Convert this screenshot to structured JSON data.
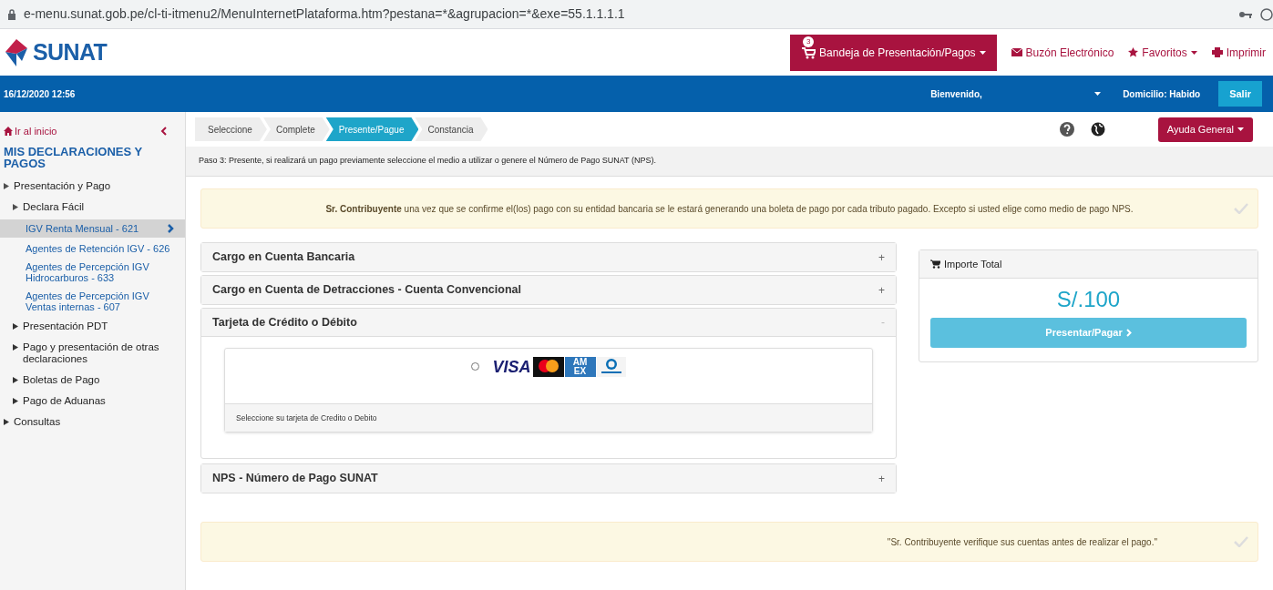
{
  "browser": {
    "url": "e-menu.sunat.gob.pe/cl-ti-itmenu2/MenuInternetPlataforma.htm?pestana=*&agrupacion=*&exe=55.1.1.1.1"
  },
  "header": {
    "logo": "SUNAT",
    "nav": [
      {
        "kind": "tray",
        "label": "Bandeja de Presentación/Pagos",
        "badge": "3"
      },
      {
        "kind": "mail",
        "label": "Buzón Electrónico"
      },
      {
        "kind": "favorites",
        "label": "Favoritos"
      },
      {
        "kind": "print",
        "label": "Imprimir"
      }
    ]
  },
  "user_bar": {
    "datetime": "16/12/2020 12:56",
    "greeting": "Bienvenido,",
    "domicile": "Domicilio: Habido",
    "logout": "Salir"
  },
  "sidebar": {
    "home": "Ir al inicio",
    "title": "MIS DECLARACIONES Y PAGOS",
    "items": [
      {
        "label": "Presentación y Pago",
        "expanded": true,
        "children": [
          {
            "label": "Declara Fácil",
            "expanded": true,
            "children": [
              {
                "label": "IGV Renta Mensual - 621",
                "selected": true
              },
              {
                "label": "Agentes de Retención IGV - 626",
                "selected": false
              },
              {
                "label": "Agentes de Percepción IGV Hidrocarburos - 633",
                "selected": false
              },
              {
                "label": "Agentes de Percepción IGV Ventas internas - 607",
                "selected": false
              }
            ]
          },
          {
            "label": "Presentación PDT",
            "expanded": false
          },
          {
            "label": "Pago y presentación de otras declaraciones",
            "expanded": false
          },
          {
            "label": "Boletas de Pago",
            "expanded": false
          },
          {
            "label": "Pago de Aduanas",
            "expanded": false
          }
        ]
      },
      {
        "label": "Consultas",
        "expanded": false
      }
    ]
  },
  "steps": [
    {
      "label": "Seleccione",
      "selected": false
    },
    {
      "label": "Complete",
      "selected": false
    },
    {
      "label": "Presente/Pague",
      "selected": true
    },
    {
      "label": "Constancia",
      "selected": false
    }
  ],
  "help_button": "Ayuda General",
  "step_note": "Paso 3: Presente, si realizará un pago previamente seleccione el medio a utilizar o genere el Número de Pago SUNAT (NPS).",
  "top_alert": "**Sr. Contribuyente** una vez que se confirme el(los) pago con su entidad bancaria se le estará generando una boleta de pago por cada tributo pagado. Excepto si usted elige como medio de pago NPS.",
  "payment_methods": [
    {
      "title": "Cargo en Cuenta Bancaria",
      "expanded": false,
      "toggle": "+"
    },
    {
      "title": "Cargo en Cuenta de Detracciones - Cuenta Convencional",
      "expanded": false,
      "toggle": "+"
    },
    {
      "title": "Tarjeta de Crédito o Débito",
      "expanded": true,
      "toggle": "-",
      "card_option": {
        "selected": false,
        "cards": [
          {
            "kind": "visa",
            "label": "VISA"
          },
          {
            "kind": "mastercard"
          },
          {
            "kind": "amex",
            "label": "AM EX"
          },
          {
            "kind": "diners"
          }
        ]
      },
      "footer": "Seleccione su tarjeta de Credito o Debito"
    },
    {
      "title": "NPS - Número de Pago SUNAT",
      "expanded": false,
      "toggle": "+"
    }
  ],
  "total": {
    "title": "Importe Total",
    "amount": "S/.100",
    "button": "Presentar/Pagar"
  },
  "bottom_alert": "\"Sr. Contribuyente verifique sus cuentas antes de realizar el pago.\""
}
